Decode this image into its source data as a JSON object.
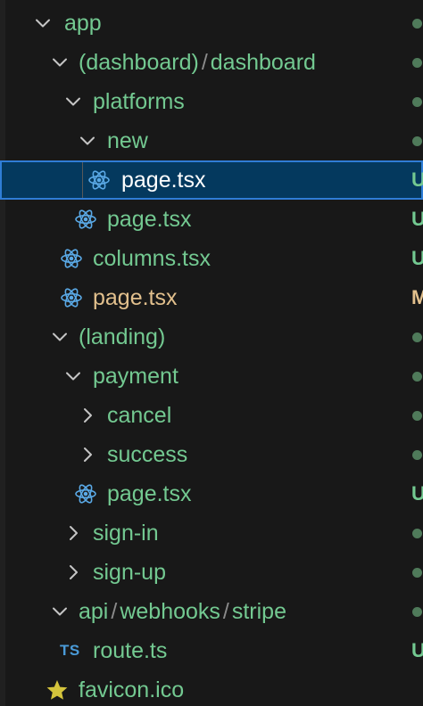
{
  "tree": {
    "rows": [
      {
        "kind": "folder",
        "expanded": true,
        "segments": [
          "app"
        ],
        "status": "dot"
      },
      {
        "kind": "folder",
        "expanded": true,
        "segments": [
          "(dashboard)",
          "dashboard"
        ],
        "separator": "/",
        "status": "dot"
      },
      {
        "kind": "folder",
        "expanded": true,
        "segments": [
          "platforms"
        ],
        "status": "dot"
      },
      {
        "kind": "folder",
        "expanded": true,
        "segments": [
          "new"
        ],
        "status": "dot"
      },
      {
        "kind": "file",
        "icon": "react-icon",
        "name": "page.tsx",
        "status": "U",
        "selected": true
      },
      {
        "kind": "file",
        "icon": "react-icon",
        "name": "page.tsx",
        "status": "U"
      },
      {
        "kind": "file",
        "icon": "react-icon",
        "name": "columns.tsx",
        "status": "U"
      },
      {
        "kind": "file",
        "icon": "react-icon",
        "name": "page.tsx",
        "status": "M",
        "modified": true
      },
      {
        "kind": "folder",
        "expanded": true,
        "segments": [
          "(landing)"
        ],
        "status": "dot"
      },
      {
        "kind": "folder",
        "expanded": true,
        "segments": [
          "payment"
        ],
        "status": "dot"
      },
      {
        "kind": "folder",
        "expanded": false,
        "segments": [
          "cancel"
        ],
        "status": "dot"
      },
      {
        "kind": "folder",
        "expanded": false,
        "segments": [
          "success"
        ],
        "status": "dot"
      },
      {
        "kind": "file",
        "icon": "react-icon",
        "name": "page.tsx",
        "status": "U"
      },
      {
        "kind": "folder",
        "expanded": false,
        "segments": [
          "sign-in"
        ],
        "status": "dot"
      },
      {
        "kind": "folder",
        "expanded": false,
        "segments": [
          "sign-up"
        ],
        "status": "dot"
      },
      {
        "kind": "folder",
        "expanded": true,
        "segments": [
          "api",
          "webhooks",
          "stripe"
        ],
        "separator": "/",
        "status": "dot"
      },
      {
        "kind": "file",
        "icon": "typescript-icon",
        "icon_text": "TS",
        "name": "route.ts",
        "status": "U"
      },
      {
        "kind": "file",
        "icon": "star-icon",
        "name": "favicon.ico",
        "status": ""
      }
    ]
  },
  "colors": {
    "untracked": "#73c991",
    "modified": "#e2c08d",
    "selected_bg": "#04395e",
    "selected_border": "#2f7dd6",
    "background": "#181818",
    "react_icon": "#5aa9e6",
    "ts_icon": "#4a9bd8",
    "star_icon": "#d4c43c"
  }
}
